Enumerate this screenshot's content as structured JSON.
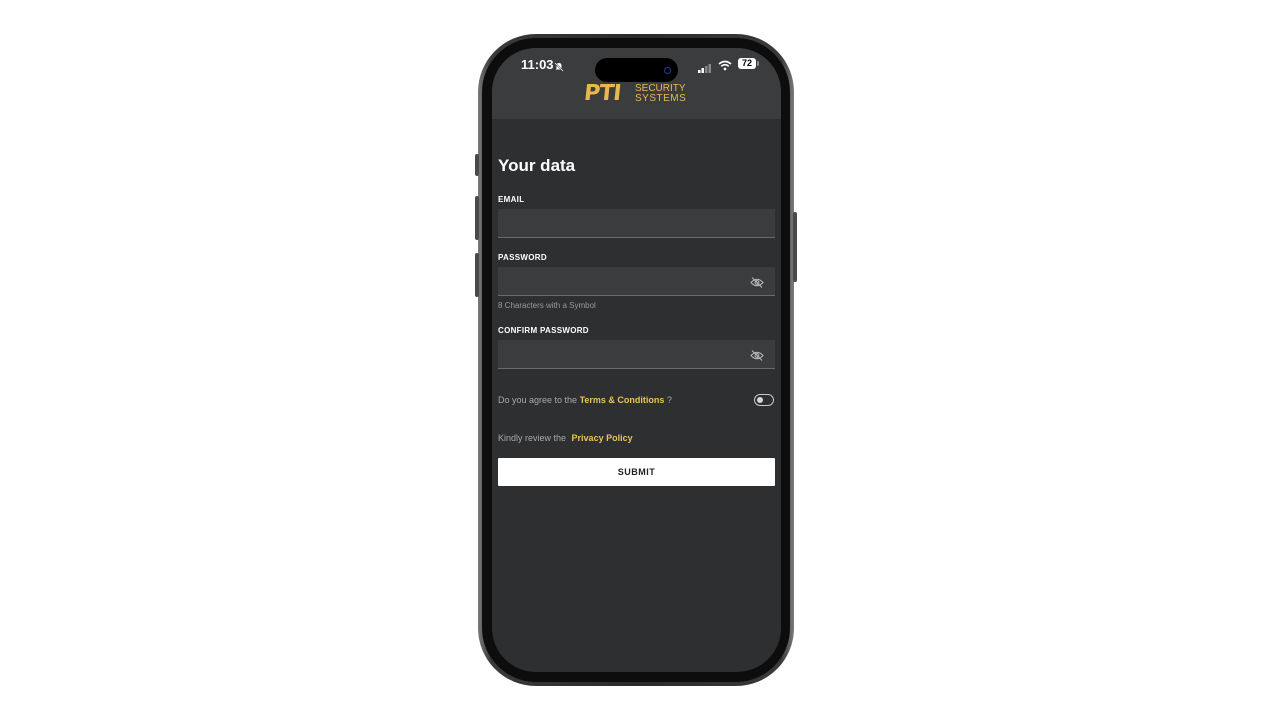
{
  "status_bar": {
    "time": "11:03",
    "battery": "72"
  },
  "brand": {
    "logo_main": "PTI",
    "logo_line1": "SECURITY",
    "logo_line2": "SYSTEMS",
    "accent_color": "#e8b94a"
  },
  "form": {
    "title": "Your data",
    "email_label": "EMAIL",
    "email_value": "",
    "password_label": "PASSWORD",
    "password_value": "",
    "password_hint": "8 Characters with a Symbol",
    "confirm_label": "CONFIRM PASSWORD",
    "confirm_value": "",
    "terms_prefix": "Do you agree to the ",
    "terms_link": "Terms & Conditions",
    "terms_suffix": " ?",
    "terms_toggle_on": false,
    "privacy_prefix": "Kindly review the ",
    "privacy_link": "Privacy Policy",
    "submit_label": "SUBMIT"
  },
  "icons": {
    "password_visibility": "eye-off-icon",
    "confirm_visibility": "eye-off-icon",
    "silent": "bell-slash-icon"
  }
}
